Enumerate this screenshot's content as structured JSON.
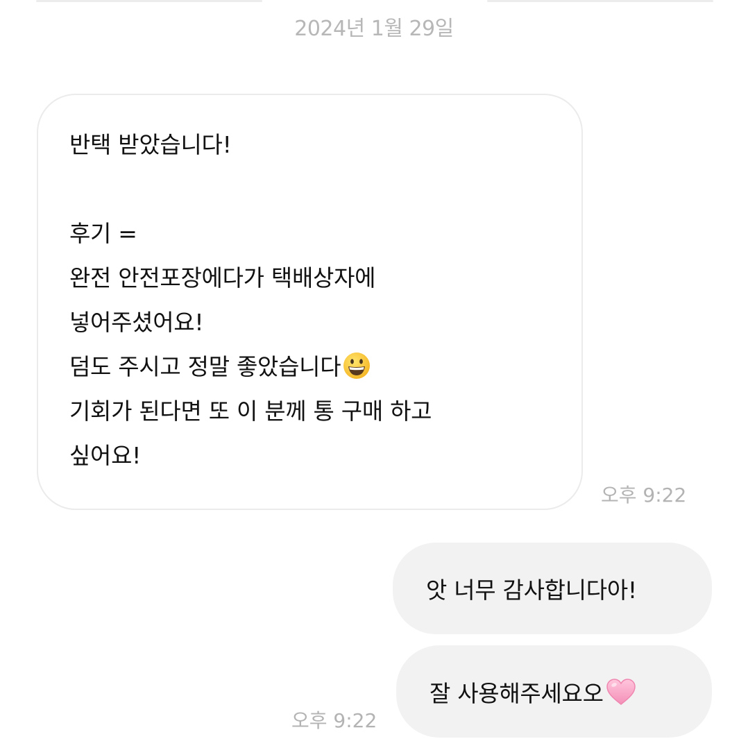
{
  "conversation": {
    "date_separator": "2024년 1월 29일",
    "incoming": {
      "lines": [
        "반택 받았습니다!",
        "",
        "후기 =",
        "완전 안전포장에다가 택배상자에",
        "넣어주셨어요!",
        "덤도 주시고 정말 좋았습니다",
        "기회가 된다면 또 이 분께 통 구매 하고",
        "싶어요!"
      ],
      "emoji": "grinning-face-emoji",
      "time": "오후 9:22"
    },
    "outgoing": [
      {
        "text": "앗 너무 감사합니다아!"
      },
      {
        "text": "잘 사용해주세요오",
        "emoji": "pink-heart-emoji"
      }
    ],
    "outgoing_time": "오후 9:22"
  },
  "colors": {
    "background": "#ffffff",
    "incoming_border": "#ebebeb",
    "outgoing_bubble": "#f2f2f2",
    "meta_text": "#b3b3b3",
    "message_text": "#111111",
    "heart": "#f7a8c8"
  }
}
